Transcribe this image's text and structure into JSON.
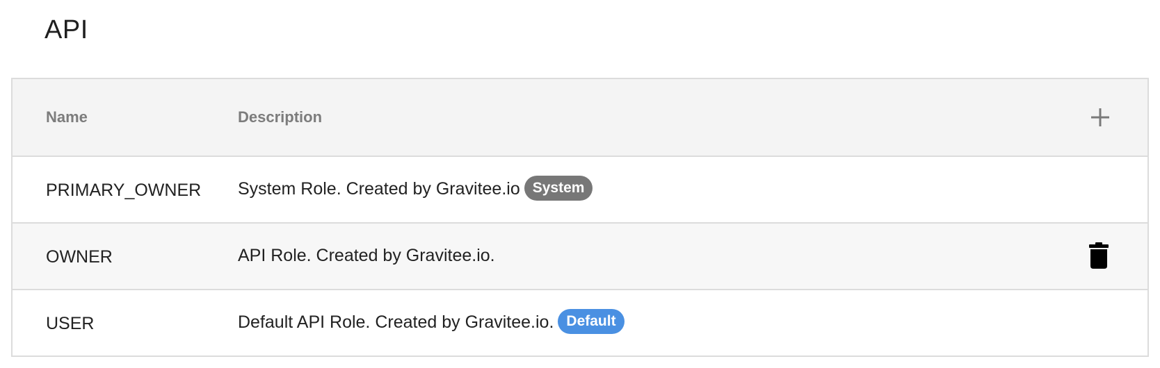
{
  "section": {
    "title": "API"
  },
  "table": {
    "headers": {
      "name": "Name",
      "description": "Description"
    },
    "add_icon": "plus-icon",
    "delete_icon": "trash-icon",
    "rows": [
      {
        "name": "PRIMARY_OWNER",
        "description": "System Role. Created by Gravitee.io",
        "badge": "System",
        "deletable": false
      },
      {
        "name": "OWNER",
        "description": "API Role. Created by Gravitee.io.",
        "badge": "",
        "deletable": true
      },
      {
        "name": "USER",
        "description": "Default API Role. Created by Gravitee.io.",
        "badge": "Default",
        "deletable": false
      }
    ]
  },
  "colors": {
    "system_badge": "#777777",
    "default_badge": "#4a90e2",
    "header_bg": "#f4f4f4",
    "alt_row_bg": "#f7f7f7",
    "border": "#dcdcdc"
  }
}
